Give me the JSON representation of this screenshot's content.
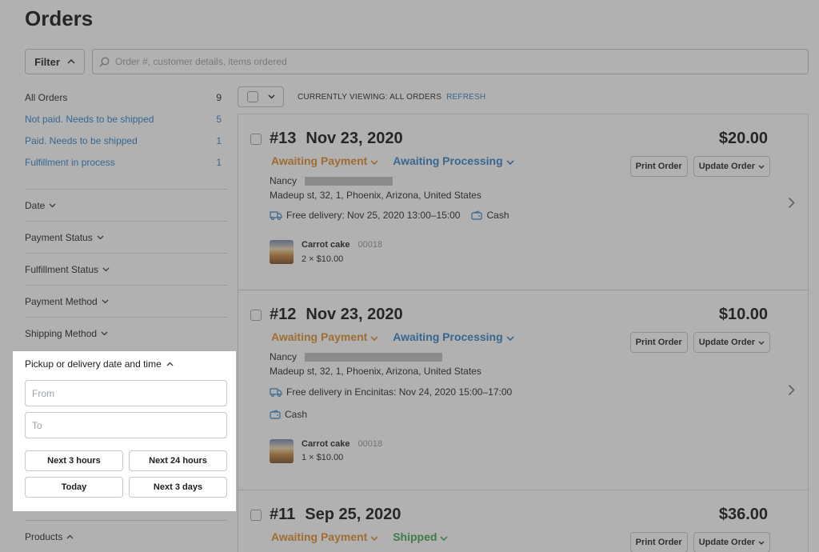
{
  "page": {
    "title": "Orders"
  },
  "filter_button": {
    "label": "Filter"
  },
  "search": {
    "placeholder": "Order #, customer details, items ordered"
  },
  "sidebar": {
    "counts": [
      {
        "label": "All Orders",
        "count": "9"
      },
      {
        "label": "Not paid. Needs to be shipped",
        "count": "5"
      },
      {
        "label": "Paid. Needs to be shipped",
        "count": "1"
      },
      {
        "label": "Fulfillment in process",
        "count": "1"
      }
    ],
    "facets": [
      {
        "label": "Date"
      },
      {
        "label": "Payment Status"
      },
      {
        "label": "Fulfillment Status"
      },
      {
        "label": "Payment Method"
      },
      {
        "label": "Shipping Method"
      }
    ],
    "delivery_filter": {
      "title": "Pickup or delivery date and time",
      "from_placeholder": "From",
      "to_placeholder": "To",
      "quick": [
        "Next 3 hours",
        "Next 24 hours",
        "Today",
        "Next 3 days"
      ]
    },
    "products": {
      "label": "Products"
    }
  },
  "toolbar": {
    "viewing": "CURRENTLY VIEWING: ALL ORDERS",
    "refresh": "REFRESH"
  },
  "order_actions": {
    "print": "Print Order",
    "update": "Update Order"
  },
  "orders": [
    {
      "number": "#13",
      "date": "Nov 23, 2020",
      "total": "$20.00",
      "payment_status": "Awaiting Payment",
      "fulfillment_status": "Awaiting Processing",
      "customer": "Nancy",
      "address": "Madeup st, 32, 1, Phoenix, Arizona, United States",
      "delivery": "Free delivery: Nov 25, 2020 13:00–15:00",
      "payment_method": "Cash",
      "item": {
        "name": "Carrot cake",
        "sku": "00018",
        "qty": "2 × $10.00"
      }
    },
    {
      "number": "#12",
      "date": "Nov 23, 2020",
      "total": "$10.00",
      "payment_status": "Awaiting Payment",
      "fulfillment_status": "Awaiting Processing",
      "customer": "Nancy",
      "address": "Madeup st, 32, 1, Phoenix, Arizona, United States",
      "delivery": "Free delivery in Encinitas: Nov 24, 2020 15:00–17:00",
      "payment_method": "Cash",
      "item": {
        "name": "Carrot cake",
        "sku": "00018",
        "qty": "1 × $10.00"
      }
    },
    {
      "number": "#11",
      "date": "Sep 25, 2020",
      "total": "$36.00",
      "payment_status": "Awaiting Payment",
      "fulfillment_status": "Shipped"
    }
  ],
  "colors": {
    "link_blue": "#2e80c5",
    "awaiting_orange": "#e08b24",
    "shipped_green": "#3fa34d",
    "dim_overlay": "#464646"
  },
  "icons": [
    "search-icon",
    "chevron-up-icon",
    "chevron-down-icon",
    "chevron-right-icon",
    "truck-icon",
    "wallet-icon"
  ]
}
